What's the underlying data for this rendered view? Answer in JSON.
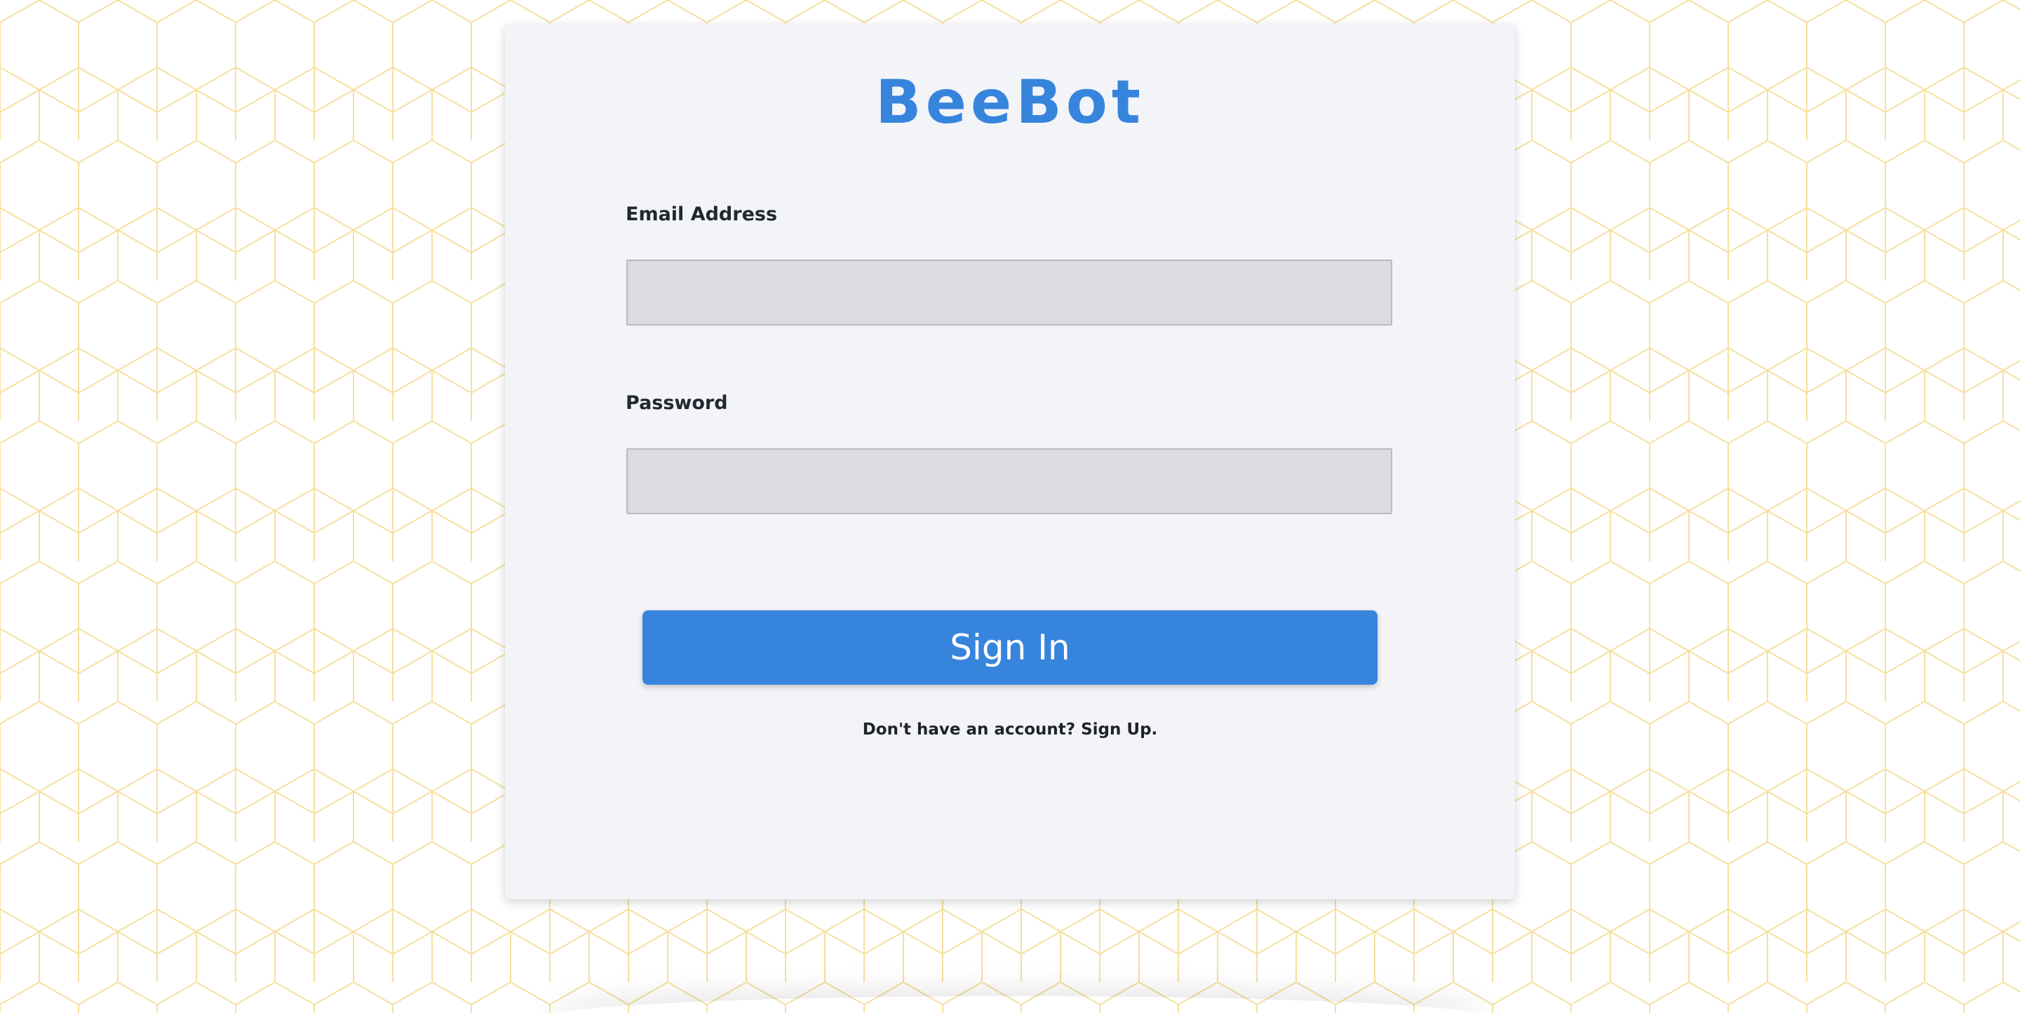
{
  "brand": {
    "title": "BeeBot"
  },
  "form": {
    "email_label": "Email Address",
    "email_value": "",
    "email_placeholder": "",
    "password_label": "Password",
    "password_value": "",
    "password_placeholder": "",
    "submit_label": "Sign In",
    "signup_prompt": "Don't have an account? Sign Up."
  },
  "colors": {
    "accent": "#3784dd",
    "card_background": "#f3f4f8",
    "input_background": "#dbdcdf",
    "honeycomb_line": "#f6df9e"
  }
}
